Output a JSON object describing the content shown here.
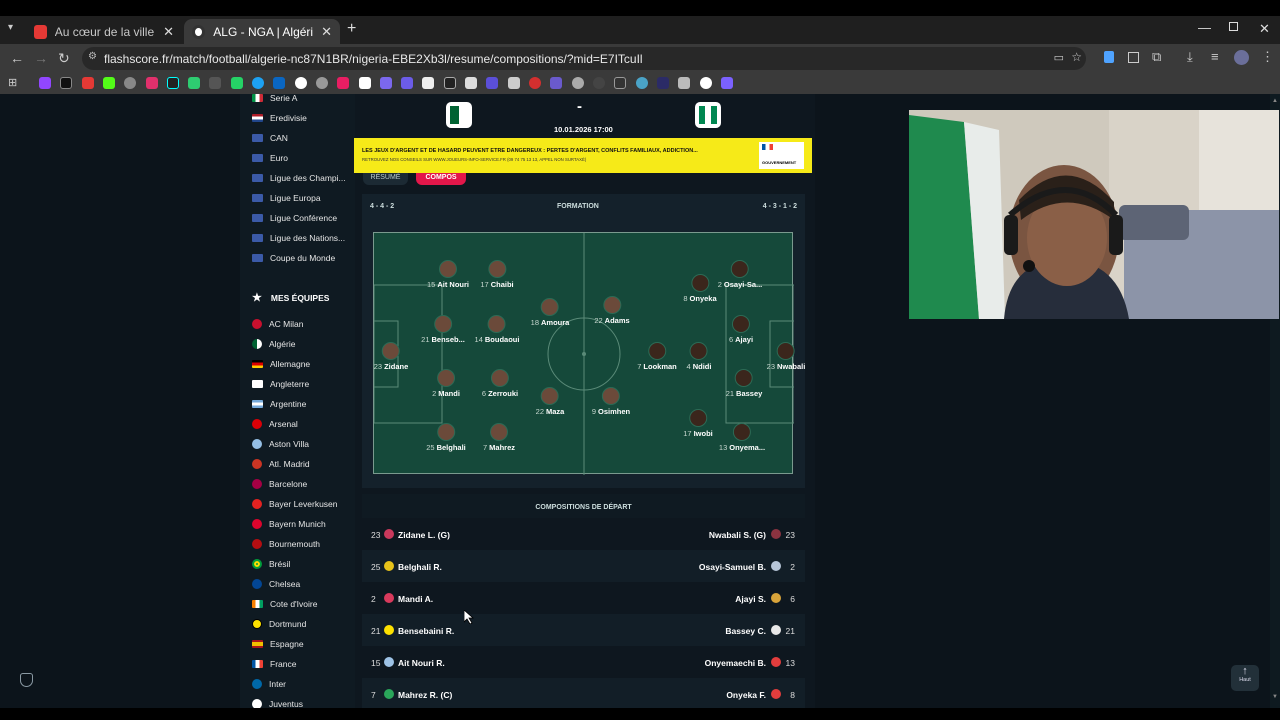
{
  "browser": {
    "tabs": [
      {
        "title": "Au cœur de la ville la plus dang"
      },
      {
        "title": "ALG - NGA | Algérie - Nigéria E"
      }
    ],
    "new_tab": "+",
    "url": "flashscore.fr/match/football/algerie-nc87N1BR/nigeria-EBE2Xb3l/resume/compositions/?mid=E7ITcuIl"
  },
  "sidebar": {
    "leagues": [
      "Serie A",
      "Eredivisie",
      "CAN",
      "Euro",
      "Ligue des Champi...",
      "Ligue Europa",
      "Ligue Conférence",
      "Ligue des Nations...",
      "Coupe du Monde"
    ],
    "my_teams_title": "MES ÉQUIPES",
    "teams": [
      "AC Milan",
      "Algérie",
      "Allemagne",
      "Angleterre",
      "Argentine",
      "Arsenal",
      "Aston Villa",
      "Atl. Madrid",
      "Barcelone",
      "Bayer Leverkusen",
      "Bayern Munich",
      "Bournemouth",
      "Brésil",
      "Chelsea",
      "Cote d'Ivoire",
      "Dortmund",
      "Espagne",
      "France",
      "Inter",
      "Juventus"
    ]
  },
  "match": {
    "score": "-",
    "datetime": "10.01.2026 17:00",
    "banner_main": "LES JEUX D'ARGENT ET DE HASARD PEUVENT ÊTRE DANGEREUX : PERTES D'ARGENT, CONFLITS FAMILIAUX, ADDICTION...",
    "banner_sub": "RETROUVEZ NOS CONSEILS SUR WWW.JOUEURS-INFO-SERVICE.FR (09 74 75 13 13, APPEL NON SURTAXÉ)",
    "banner_logo": "GOUVERNEMENT",
    "tabs": [
      "RÉSUMÉ",
      "COMPOS"
    ]
  },
  "formation": {
    "home": "4 - 4 - 2",
    "title": "FORMATION",
    "away": "4 - 3 - 1 - 2"
  },
  "pitch_players": [
    {
      "num": "15",
      "name": "Ait Nouri"
    },
    {
      "num": "17",
      "name": "Chaibi"
    },
    {
      "num": "18",
      "name": "Amoura"
    },
    {
      "num": "22",
      "name": "Adams"
    },
    {
      "num": "21",
      "name": "Benseb..."
    },
    {
      "num": "14",
      "name": "Boudaoui"
    },
    {
      "num": "23",
      "name": "Zidane"
    },
    {
      "num": "2",
      "name": "Mandi"
    },
    {
      "num": "6",
      "name": "Zerrouki"
    },
    {
      "num": "22",
      "name": "Maza"
    },
    {
      "num": "9",
      "name": "Osimhen"
    },
    {
      "num": "25",
      "name": "Belghali"
    },
    {
      "num": "7",
      "name": "Mahrez"
    },
    {
      "num": "8",
      "name": "Onyeka"
    },
    {
      "num": "2",
      "name": "Osayi-Sa..."
    },
    {
      "num": "7",
      "name": "Lookman"
    },
    {
      "num": "4",
      "name": "Ndidi"
    },
    {
      "num": "6",
      "name": "Ajayi"
    },
    {
      "num": "23",
      "name": "Nwabali"
    },
    {
      "num": "21",
      "name": "Bassey"
    },
    {
      "num": "17",
      "name": "Iwobi"
    },
    {
      "num": "13",
      "name": "Onyema..."
    }
  ],
  "lineups": {
    "title": "COMPOSITIONS DE DÉPART",
    "rows": [
      {
        "ln": "23",
        "lname": "Zidane L. (G)",
        "rname": "Nwabali S. (G)",
        "rn": "23"
      },
      {
        "ln": "25",
        "lname": "Belghali R.",
        "rname": "Osayi-Samuel B.",
        "rn": "2"
      },
      {
        "ln": "2",
        "lname": "Mandi A.",
        "rname": "Ajayi S.",
        "rn": "6"
      },
      {
        "ln": "21",
        "lname": "Bensebaini R.",
        "rname": "Bassey C.",
        "rn": "21"
      },
      {
        "ln": "15",
        "lname": "Ait Nouri R.",
        "rname": "Onyemaechi B.",
        "rn": "13"
      },
      {
        "ln": "7",
        "lname": "Mahrez R. (C)",
        "rname": "Onyeka F.",
        "rn": "8"
      }
    ]
  },
  "back_to_top": "Haut"
}
